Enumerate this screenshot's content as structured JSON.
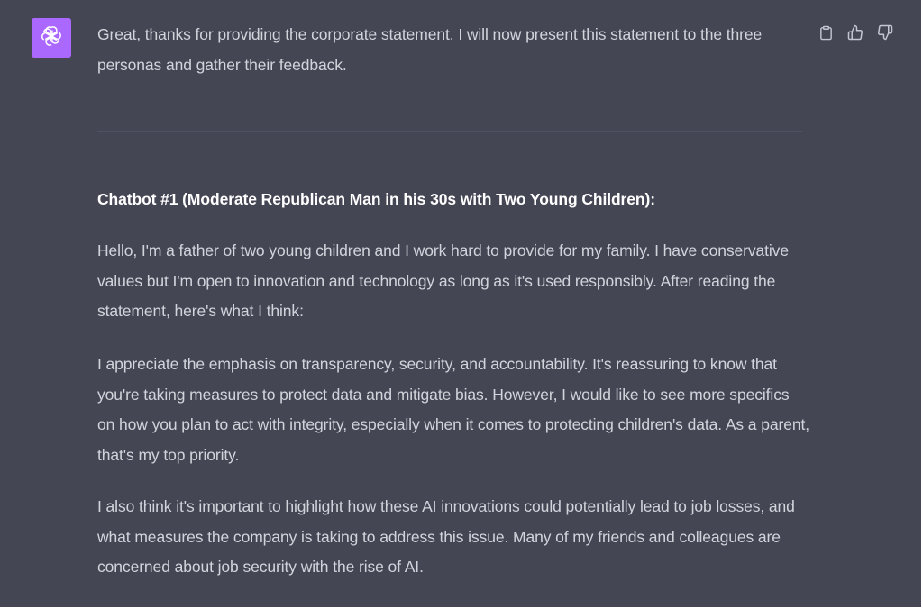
{
  "assistant": {
    "avatar_icon": "openai-logo-icon",
    "avatar_color": "#ab68ff"
  },
  "message": {
    "intro": "Great, thanks for providing the corporate statement. I will now present this statement to the three personas and gather their feedback."
  },
  "actions": {
    "copy_icon": "clipboard-icon",
    "like_icon": "thumbs-up-icon",
    "dislike_icon": "thumbs-down-icon"
  },
  "response": {
    "heading": "Chatbot #1 (Moderate Republican Man in his 30s with Two Young Children):",
    "paragraphs": [
      "Hello, I'm a father of two young children and I work hard to provide for my family. I have conservative values but I'm open to innovation and technology as long as it's used responsibly. After reading the statement, here's what I think:",
      "I appreciate the emphasis on transparency, security, and accountability. It's reassuring to know that you're taking measures to protect data and mitigate bias. However, I would like to see more specifics on how you plan to act with integrity, especially when it comes to protecting children's data. As a parent, that's my top priority.",
      "I also think it's important to highlight how these AI innovations could potentially lead to job losses, and what measures the company is taking to address this issue. Many of my friends and colleagues are concerned about job security with the rise of AI."
    ]
  },
  "colors": {
    "background": "#444654",
    "text": "#d1d5db",
    "heading": "#ffffff",
    "icon": "#c5c5d2"
  }
}
